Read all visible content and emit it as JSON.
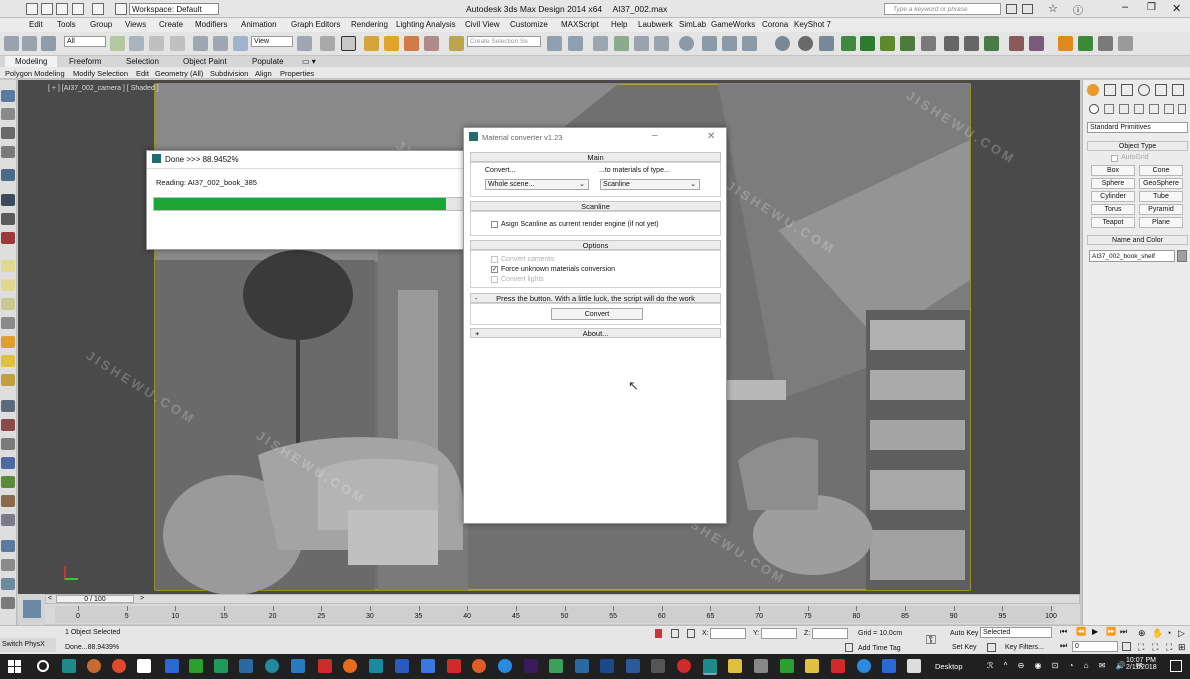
{
  "app": {
    "title": "Autodesk 3ds Max Design 2014 x64",
    "file": "AI37_002.max",
    "workspace": "Workspace: Default",
    "search_placeholder": "Type a keyword or phrase"
  },
  "menu": [
    "Edit",
    "Tools",
    "Group",
    "Views",
    "Create",
    "Modifiers",
    "Animation",
    "Graph Editors",
    "Rendering",
    "Lighting Analysis",
    "Civil View",
    "Customize",
    "MAXScript",
    "Help",
    "Laubwerk",
    "SimLab",
    "GameWorks",
    "Corona",
    "KeyShot 7"
  ],
  "toolbar": {
    "selection_filter": "All",
    "ref_coord": "View",
    "named_selection_placeholder": "Create Selection Se"
  },
  "ribbon_tabs": [
    "Modeling",
    "Freeform",
    "Selection",
    "Object Paint",
    "Populate"
  ],
  "ribbon_sub": [
    "Polygon Modeling",
    "Modify Selection",
    "Edit",
    "Geometry (All)",
    "Subdivision",
    "Align",
    "Properties"
  ],
  "viewport_label": "[ + ] [AI37_002_camera ] [ Shaded ]",
  "command_panel": {
    "primitives_dropdown": "Standard Primitives",
    "object_type_header": "Object Type",
    "autogrid_label": "AutoGrid",
    "buttons": [
      "Box",
      "Cone",
      "Sphere",
      "GeoSphere",
      "Cylinder",
      "Tube",
      "Torus",
      "Pyramid",
      "Teapot",
      "Plane"
    ],
    "name_color_header": "Name and Color",
    "object_name": "AI37_002_book_shelf"
  },
  "progress_dialog": {
    "title": "Done >>> 88.9452%",
    "reading": "Reading: AI37_002_book_385",
    "progress": 0.8895
  },
  "material_converter": {
    "title": "Material converter v1.23",
    "main_header": "Main",
    "convert_label": "Convert...",
    "to_materials_label": "...to materials of type...",
    "scope_value": "Whole scene...",
    "type_value": "Scanline",
    "scanline_header": "Scanline",
    "assign_scanline": "Asign Scanline as current render engine (if not yet)",
    "options_header": "Options",
    "convert_cameras": "Convert cameras",
    "force_unknown": "Force unknown materials conversion",
    "convert_lights": "Convert lights",
    "hint": "Press the button. With a little luck, the script will do the work",
    "convert_button": "Convert",
    "about_header": "About..."
  },
  "trackbar": {
    "frame_counter": "0 / 100",
    "ticks": [
      "0",
      "5",
      "10",
      "15",
      "20",
      "25",
      "30",
      "35",
      "40",
      "45",
      "50",
      "55",
      "60",
      "65",
      "70",
      "75",
      "80",
      "85",
      "90",
      "95",
      "100"
    ]
  },
  "status": {
    "left_label": "Switch PhysX",
    "selection": "1 Object Selected",
    "prompt": "Done...88.9439%",
    "x_label": "X:",
    "y_label": "Y:",
    "z_label": "Z:",
    "grid": "Grid = 10.0cm",
    "add_time_tag": "Add Time Tag",
    "auto_key": "Auto Key",
    "set_key": "Set Key",
    "selected_dropdown": "Selected",
    "key_filters": "Key Filters...",
    "frame_value": "0"
  },
  "taskbar": {
    "desktop_label": "Desktop",
    "time": "10:07 PM",
    "date": "2/11/2018"
  },
  "watermark": "JISHEWU.COM",
  "colors": {
    "progress_fill": "#1aa534",
    "viewport_border": "#e8d600",
    "taskbar": "#202020"
  }
}
